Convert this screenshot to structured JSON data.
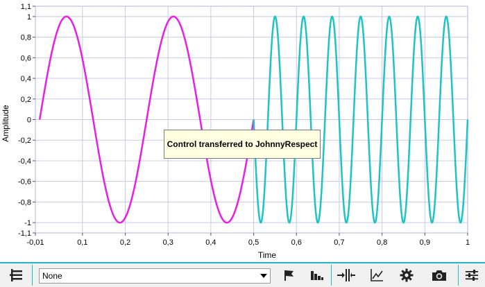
{
  "chart_data": {
    "type": "line",
    "xlabel": "Time",
    "ylabel": "Amplitude",
    "xlim": [
      -0.01,
      1.0
    ],
    "ylim": [
      -1.1,
      1.1
    ],
    "x_ticks": [
      "-0,01",
      "0,1",
      "0,2",
      "0,3",
      "0,4",
      "0,5",
      "0,6",
      "0,7",
      "0,8",
      "0,9",
      "1"
    ],
    "y_ticks": [
      "1,1",
      "1",
      "0,8",
      "0,6",
      "0,4",
      "0,2",
      "0",
      "-0,2",
      "-0,4",
      "-0,6",
      "-0,8",
      "-1",
      "-1,1"
    ],
    "grid": true,
    "series": [
      {
        "x_start": 0.0,
        "x_end": 0.5,
        "frequency_hz": 4,
        "amplitude": 1,
        "shape": "sine",
        "color": "#e81ee8"
      },
      {
        "x_start": 0.5,
        "x_end": 1.0,
        "frequency_hz": 15,
        "amplitude": 1,
        "shape": "sine",
        "color": "#1ec3c3"
      }
    ]
  },
  "tooltip": {
    "text": "Control transferred to JohnnyRespect"
  },
  "toolbar": {
    "selector_value": "None",
    "accent_color": "#22b7c9",
    "icons": [
      "legend-icon",
      "flag-icon",
      "histogram-icon",
      "fit-width-icon",
      "trend-icon",
      "gear-icon",
      "camera-icon",
      "sliders-icon"
    ]
  }
}
